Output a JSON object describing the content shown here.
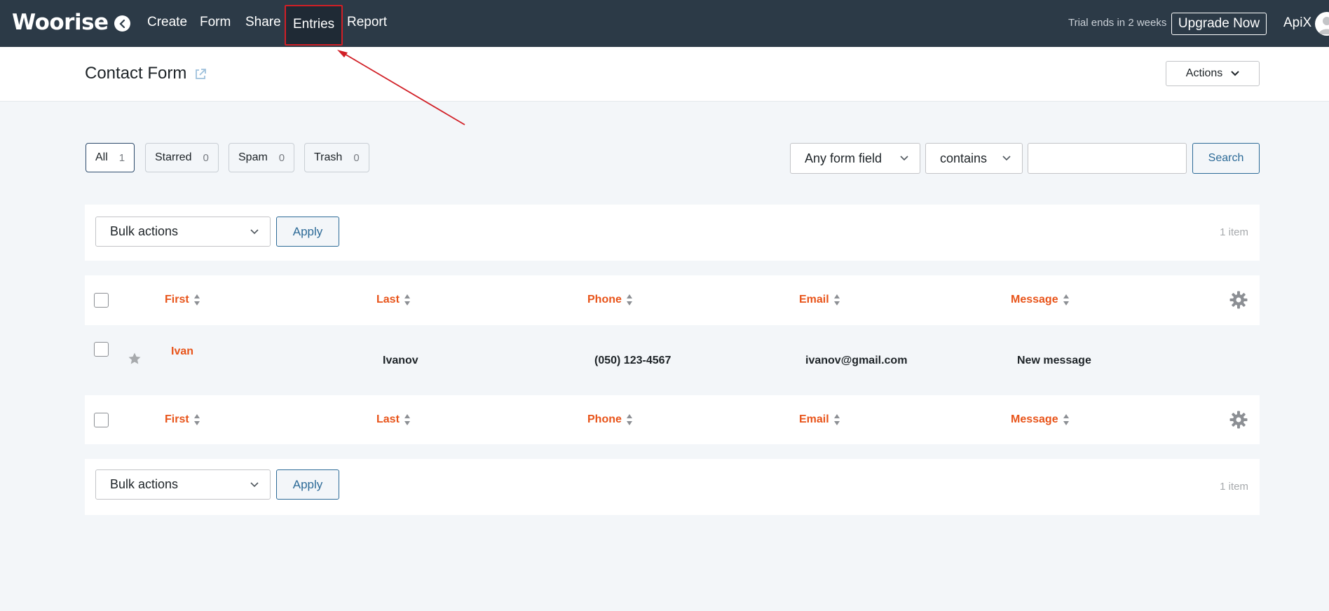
{
  "topbar": {
    "logo": "Woorise",
    "nav": [
      "Create",
      "Form",
      "Share",
      "Entries",
      "Report"
    ],
    "active_nav": "Entries",
    "trial_text": "Trial ends in 2 weeks",
    "upgrade_label": "Upgrade Now",
    "user_name": "ApiX"
  },
  "header": {
    "title": "Contact Form",
    "actions_label": "Actions"
  },
  "filters": {
    "pills": [
      {
        "label": "All",
        "count": "1"
      },
      {
        "label": "Starred",
        "count": "0"
      },
      {
        "label": "Spam",
        "count": "0"
      },
      {
        "label": "Trash",
        "count": "0"
      }
    ],
    "field_select": "Any form field",
    "operator_select": "contains",
    "search_value": "",
    "search_label": "Search"
  },
  "bulk": {
    "select_label": "Bulk actions",
    "apply_label": "Apply",
    "items_count": "1 item"
  },
  "table": {
    "columns": [
      "First",
      "Last",
      "Phone",
      "Email",
      "Message"
    ],
    "rows": [
      {
        "first": "Ivan",
        "last": "Ivanov",
        "phone": "(050) 123-4567",
        "email": "ivanov@gmail.com",
        "message": "New message"
      }
    ]
  },
  "colors": {
    "topbar_bg": "#2c3a47",
    "accent_orange": "#e8541a",
    "button_blue": "#2c6a97",
    "annotation_red": "#d11f26"
  }
}
